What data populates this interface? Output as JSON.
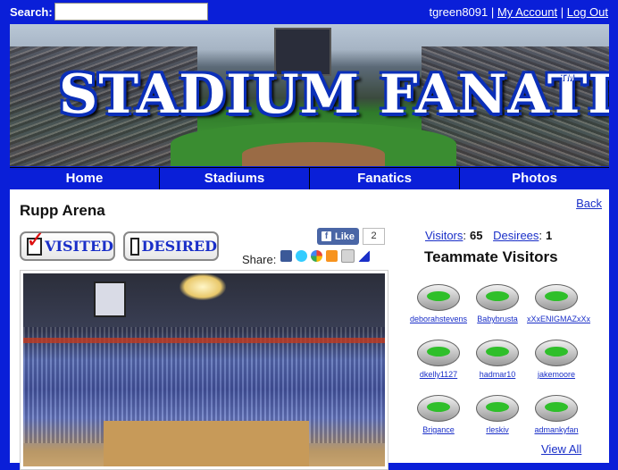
{
  "search": {
    "label": "Search:",
    "value": "",
    "placeholder": ""
  },
  "user": {
    "username": "tgreen8091",
    "separator1": "|",
    "account_link": "My Account",
    "separator2": "|",
    "logout_link": "Log Out"
  },
  "banner": {
    "logo_text": "STADIUM FANATIC",
    "tm": "TM"
  },
  "nav": {
    "items": [
      "Home",
      "Stadiums",
      "Fanatics",
      "Photos"
    ]
  },
  "page": {
    "back_link": "Back",
    "title": "Rupp Arena",
    "visited_label": "VISITED",
    "desired_label": "DESIRED",
    "like_label": "Like",
    "like_count": "2",
    "share_label": "Share:"
  },
  "stats": {
    "visitors_label": "Visitors",
    "visitors_colon": ":",
    "visitors_count": "65",
    "desirees_label": "Desirees",
    "desirees_colon": ":",
    "desirees_count": "1"
  },
  "teammates": {
    "heading": "Teammate Visitors",
    "items": [
      "deborahstevens",
      "Babybrusta",
      "xXxENIGMAZxXx",
      "dkelly1127",
      "hadmar10",
      "jakemoore",
      "Brigance",
      "rleskiv",
      "admankyfan"
    ],
    "view_all": "View All"
  },
  "colors": {
    "page_bg": "#0a1fd8",
    "link": "#1a2fc8",
    "like_bg": "#4a66a6",
    "check": "#dd1111"
  }
}
